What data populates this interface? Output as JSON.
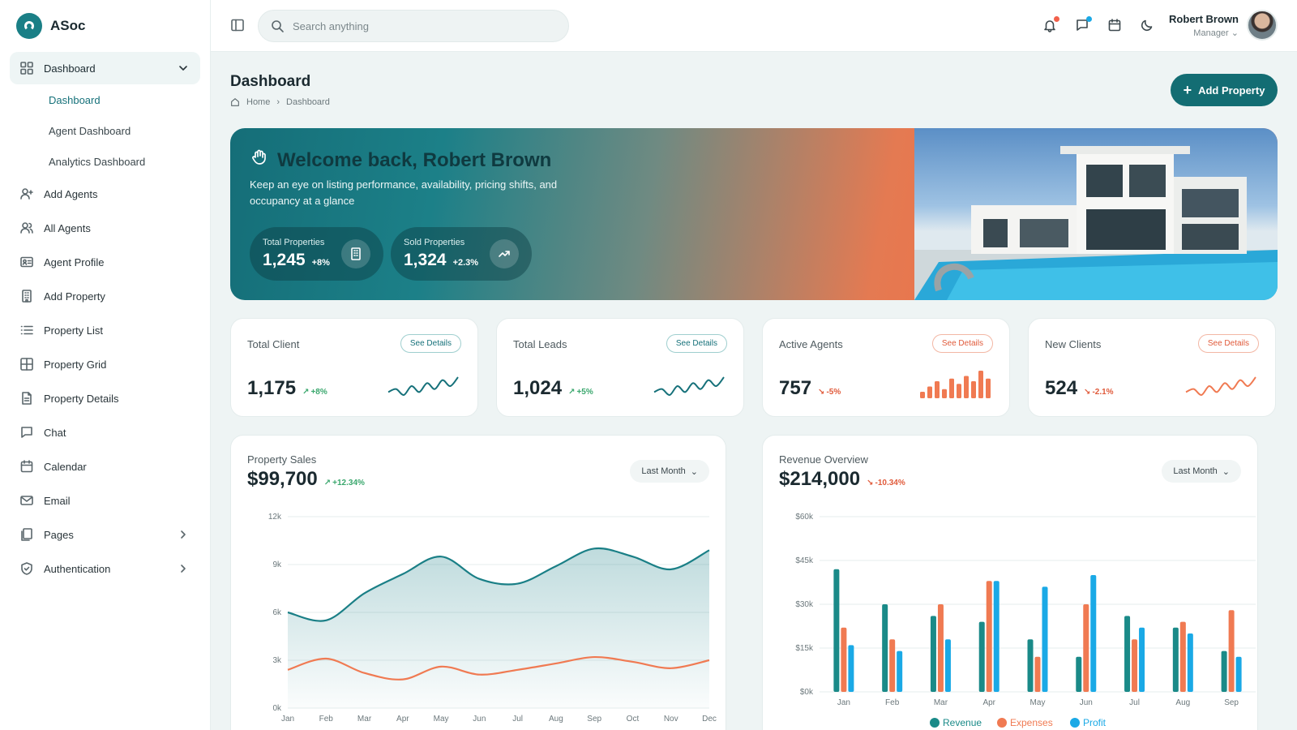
{
  "brand": {
    "name": "ASoc",
    "accent": "#16717a"
  },
  "search": {
    "placeholder": "Search anything"
  },
  "user": {
    "name": "Robert Brown",
    "role": "Manager"
  },
  "sidebar": {
    "group": {
      "label": "Dashboard",
      "icon": "grid-icon"
    },
    "sub_items": [
      "Dashboard",
      "Agent Dashboard",
      "Analytics Dashboard"
    ],
    "active_sub": "Dashboard",
    "items": [
      {
        "label": "Add Agents",
        "icon": "user-plus-icon"
      },
      {
        "label": "All Agents",
        "icon": "users-icon"
      },
      {
        "label": "Agent Profile",
        "icon": "id-card-icon"
      },
      {
        "label": "Add Property",
        "icon": "building-icon"
      },
      {
        "label": "Property List",
        "icon": "list-icon"
      },
      {
        "label": "Property Grid",
        "icon": "grid-square-icon"
      },
      {
        "label": "Property Details",
        "icon": "document-icon"
      },
      {
        "label": "Chat",
        "icon": "chat-icon"
      },
      {
        "label": "Calendar",
        "icon": "calendar-icon"
      },
      {
        "label": "Email",
        "icon": "mail-icon"
      },
      {
        "label": "Pages",
        "icon": "pages-icon",
        "has_children": true
      },
      {
        "label": "Authentication",
        "icon": "shield-icon",
        "has_children": true
      }
    ]
  },
  "header": {
    "title": "Dashboard",
    "breadcrumb": {
      "home": "Home",
      "current": "Dashboard"
    },
    "add_button": "Add Property"
  },
  "hero": {
    "title": "Welcome back, Robert Brown",
    "subtitle": "Keep an eye on listing performance, availability, pricing shifts, and occupancy at a glance",
    "total": {
      "label": "Total Properties",
      "value": "1,245",
      "change": "+8%"
    },
    "sold": {
      "label": "Sold Properties",
      "value": "1,324",
      "change": "+2.3%"
    }
  },
  "stats": [
    {
      "title": "Total Client",
      "value": "1,175",
      "change": "+8%",
      "trend": "up",
      "button": "See Details",
      "color": "#16717a",
      "spark": "line",
      "spark_values": [
        4,
        5,
        3,
        6,
        4,
        7,
        5,
        8,
        6,
        9
      ]
    },
    {
      "title": "Total Leads",
      "value": "1,024",
      "change": "+5%",
      "trend": "up",
      "button": "See Details",
      "color": "#16717a",
      "spark": "line",
      "spark_values": [
        4,
        5,
        3,
        6,
        4,
        7,
        5,
        8,
        6,
        9
      ]
    },
    {
      "title": "Active Agents",
      "value": "757",
      "change": "-5%",
      "trend": "down",
      "button": "See Details",
      "color": "#f07a52",
      "spark": "bar",
      "spark_values": [
        4,
        6,
        8,
        5,
        9,
        7,
        10,
        8,
        12,
        9
      ]
    },
    {
      "title": "New Clients",
      "value": "524",
      "change": "-2.1%",
      "trend": "down",
      "button": "See Details",
      "color": "#f07a52",
      "spark": "line",
      "spark_values": [
        4,
        5,
        3,
        6,
        4,
        7,
        5,
        8,
        6,
        9
      ]
    }
  ],
  "sales_card": {
    "title": "Property Sales",
    "value": "$99,700",
    "change": "+12.34%",
    "dropdown": "Last Month"
  },
  "revenue_card": {
    "title": "Revenue Overview",
    "value": "$214,000",
    "change": "-10.34%",
    "dropdown": "Last Month"
  },
  "chart_data": [
    {
      "type": "area",
      "categories": [
        "Jan",
        "Feb",
        "Mar",
        "Apr",
        "May",
        "Jun",
        "Jul",
        "Aug",
        "Sep",
        "Oct",
        "Nov",
        "Dec"
      ],
      "yticks": [
        "0k",
        "3k",
        "6k",
        "9k",
        "12k"
      ],
      "ylim": [
        0,
        12000
      ],
      "series": [
        {
          "values": [
            6000,
            5500,
            7200,
            8400,
            9500,
            8100,
            7800,
            8900,
            10000,
            9500,
            8700,
            9900
          ],
          "color": "#1a7f86"
        },
        {
          "values": [
            2400,
            3100,
            2200,
            1800,
            2600,
            2100,
            2400,
            2800,
            3200,
            2900,
            2500,
            3000
          ],
          "color": "#f07a52"
        }
      ],
      "grid": true
    },
    {
      "type": "bar",
      "categories": [
        "Jan",
        "Feb",
        "Mar",
        "Apr",
        "May",
        "Jun",
        "Jul",
        "Aug",
        "Sep"
      ],
      "yticks": [
        "$0k",
        "$15k",
        "$30k",
        "$45k",
        "$60k"
      ],
      "ylim": [
        0,
        60000
      ],
      "series": [
        {
          "name": "Revenue",
          "values": [
            42000,
            30000,
            26000,
            24000,
            18000,
            12000,
            26000,
            22000,
            14000
          ],
          "color": "#1a8a88"
        },
        {
          "name": "Expenses",
          "values": [
            22000,
            18000,
            30000,
            38000,
            12000,
            30000,
            18000,
            24000,
            28000
          ],
          "color": "#f07a52"
        },
        {
          "name": "Profit",
          "values": [
            16000,
            14000,
            18000,
            38000,
            36000,
            40000,
            22000,
            20000,
            12000
          ],
          "color": "#1aa9e6"
        }
      ],
      "legend": "bottom",
      "grid": true
    }
  ]
}
